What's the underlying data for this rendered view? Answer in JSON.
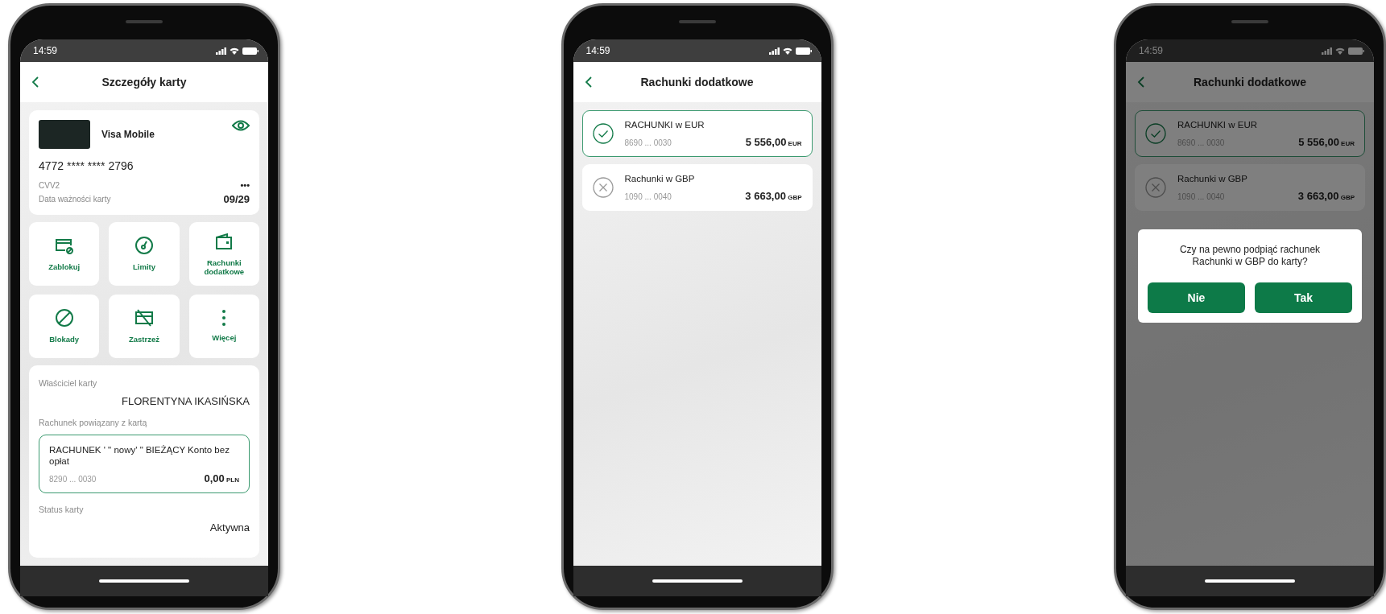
{
  "phones": [
    {
      "kind": "card_details",
      "status_time": "14:59",
      "title": "Szczegóły karty",
      "card": {
        "name": "Visa Mobile",
        "number": "4772 **** **** 2796",
        "cvv_label": "CVV2",
        "cvv_value": "•••",
        "expiry_label": "Data ważności karty",
        "expiry_value": "09/29"
      },
      "actions": [
        {
          "kind": "card-block",
          "label": "Zablokuj"
        },
        {
          "kind": "gauge",
          "label": "Limity"
        },
        {
          "kind": "wallet",
          "label": "Rachunki dodatkowe"
        },
        {
          "kind": "prohibited",
          "label": "Blokady"
        },
        {
          "kind": "card-crossed",
          "label": "Zastrzeż"
        },
        {
          "kind": "more",
          "label": "Więcej"
        }
      ],
      "owner_label": "Właściciel karty",
      "owner": "FLORENTYNA IKASIŃSKA",
      "linked_label": "Rachunek powiązany z kartą",
      "linked_account": {
        "name": "RACHUNEK ' \" nowy' \" BIEŻĄCY Konto bez opłat",
        "number": "8290 ... 0030",
        "amount": "0,00",
        "currency": "PLN"
      },
      "status_label": "Status karty",
      "status": "Aktywna"
    },
    {
      "kind": "accounts",
      "status_time": "14:59",
      "title": "Rachunki dodatkowe",
      "accounts": [
        {
          "name": "RACHUNKI w EUR",
          "number": "8690 ... 0030",
          "amount": "5 556,00",
          "currency": "EUR",
          "selected": true
        },
        {
          "name": "Rachunki w GBP",
          "number": "1090 ... 0040",
          "amount": "3 663,00",
          "currency": "GBP",
          "selected": false
        }
      ]
    },
    {
      "kind": "accounts",
      "status_time": "14:59",
      "title": "Rachunki dodatkowe",
      "accounts": [
        {
          "name": "RACHUNKI w EUR",
          "number": "8690 ... 0030",
          "amount": "5 556,00",
          "currency": "EUR",
          "selected": true
        },
        {
          "name": "Rachunki w GBP",
          "number": "1090 ... 0040",
          "amount": "3 663,00",
          "currency": "GBP",
          "selected": false
        }
      ],
      "dialog": {
        "message": "Czy na pewno podpiąć rachunek Rachunki w GBP do karty?",
        "buttons": [
          "Nie",
          "Tak"
        ]
      }
    }
  ]
}
